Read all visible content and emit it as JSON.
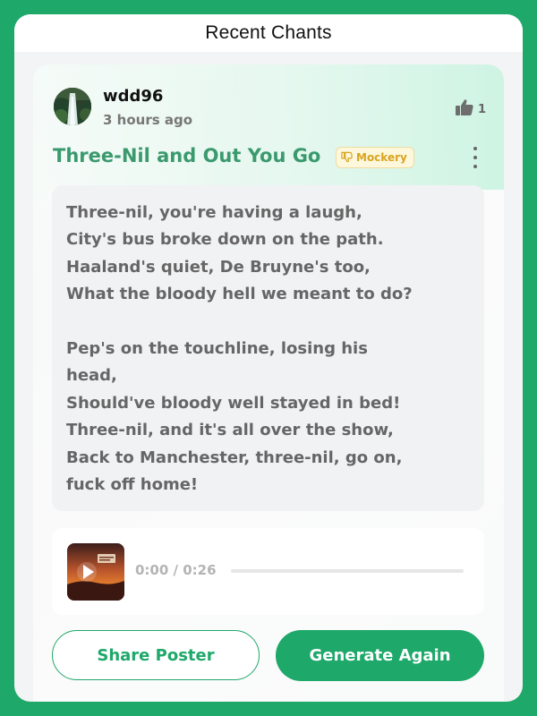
{
  "header": {
    "title": "Recent Chants"
  },
  "post": {
    "username": "wdd96",
    "time_ago": "3 hours ago",
    "likes": "1",
    "title": "Three-Nil and Out You Go",
    "tag": {
      "label": "Mockery",
      "icon": "thumbs-down-icon",
      "color": "#d9a520"
    },
    "lyrics": {
      "verse1": [
        "Three-nil, you're having a laugh,",
        "City's bus broke down on the path.",
        "Haaland's quiet, De Bruyne's too,",
        "What the bloody hell we meant to do?"
      ],
      "verse2": [
        "Pep's on the touchline, losing his",
        "head,",
        "Should've bloody well stayed in bed!",
        "Three-nil, and it's all over the show,",
        "Back to Manchester, three-nil, go on,",
        "fuck off home!"
      ]
    }
  },
  "audio": {
    "time": "0:00 / 0:26",
    "progress": 0,
    "thumbnail_icon": "play-icon"
  },
  "actions": {
    "share_label": "Share Poster",
    "generate_label": "Generate Again"
  },
  "colors": {
    "brand": "#1ea86a",
    "title": "#3a9a6e",
    "lyrics_text": "#666666"
  }
}
